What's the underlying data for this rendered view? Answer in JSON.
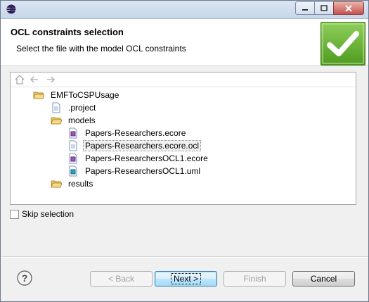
{
  "header": {
    "title": "OCL constraints selection",
    "subtitle": "Select the file with the model OCL constraints"
  },
  "tree": {
    "root": "EMFToCSPUsage",
    "items": [
      {
        "label": ".project",
        "icon": "file-icon"
      },
      {
        "label": "models",
        "icon": "folder-open-icon"
      },
      {
        "label": "Papers-Researchers.ecore",
        "icon": "ecore-icon"
      },
      {
        "label": "Papers-Researchers.ecore.ocl",
        "icon": "file-icon",
        "selected": true
      },
      {
        "label": "Papers-ResearchersOCL1.ecore",
        "icon": "ecore-icon"
      },
      {
        "label": "Papers-ResearchersOCL1.uml",
        "icon": "uml-icon"
      },
      {
        "label": "results",
        "icon": "folder-icon"
      }
    ]
  },
  "skip_selection": {
    "label": "Skip selection",
    "checked": false
  },
  "buttons": {
    "back": "< Back",
    "next": "Next >",
    "finish": "Finish",
    "cancel": "Cancel"
  },
  "colors": {
    "accent": "#4e9a1f",
    "selection": "#f0f0f0"
  }
}
